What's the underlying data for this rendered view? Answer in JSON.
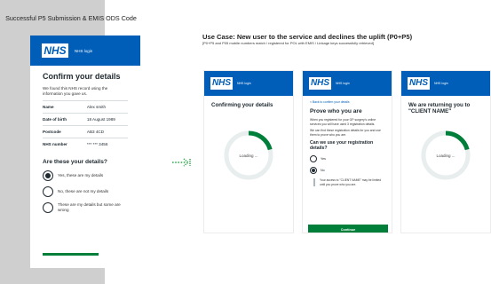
{
  "left": {
    "title": "Successful P5 Submission & EMIS ODS Code",
    "card": {
      "logo": "NHS",
      "login_label": "NHS login",
      "heading": "Confirm your details",
      "intro": "We found this NHS record using the information you gave us.",
      "details": [
        {
          "key": "Name",
          "value": "Alex smith"
        },
        {
          "key": "Date of birth",
          "value": "18 August 1989"
        },
        {
          "key": "Postcode",
          "value": "AB3 4CD"
        },
        {
          "key": "NHS number",
          "value": "*** *** 3456"
        }
      ],
      "question": "Are these your details?",
      "options": [
        "Yes, these are my details",
        "No, these are not my details",
        "These are my details but some are wrong"
      ],
      "selected_option": 0
    }
  },
  "use_case": {
    "title": "Use Case: New user to the service and declines the uplift (P0+P5)",
    "subtitle": "[P0+P5 and P05 mobile numbers match / registered for POL with EMIS / Linkage keys successfully retrieved]"
  },
  "cards": [
    {
      "logo": "NHS",
      "login_label": "NHS login",
      "title": "Confirming your details",
      "loading": "Loading ..."
    },
    {
      "logo": "NHS",
      "login_label": "NHS login",
      "back_link": "< Back to confirm your details",
      "title": "Prove who you are",
      "para1": "When you registered for your GP surgery's online services you will have used 3 registration details.",
      "para2": "We can find these registration details for you and use them to prove who you are.",
      "question": "Can we use your registration details?",
      "options": [
        "Yes",
        "No"
      ],
      "selected_option": 1,
      "note": "Your access to \"CLIENT NAME\" may be limited until you prove who you are.",
      "continue_label": "Continue"
    },
    {
      "logo": "NHS",
      "login_label": "NHS login",
      "title": "We are returning you to \"CLIENT NAME\"",
      "loading": "Loading ..."
    }
  ],
  "colors": {
    "nhs_blue": "#005eb8",
    "nhs_green": "#007f3b",
    "arrow_green": "#2fa84f",
    "spinner_track": "#e8edee"
  },
  "icons": {
    "arrow": "dotted-right-arrow-icon",
    "spinner": "loading-spinner-icon"
  }
}
